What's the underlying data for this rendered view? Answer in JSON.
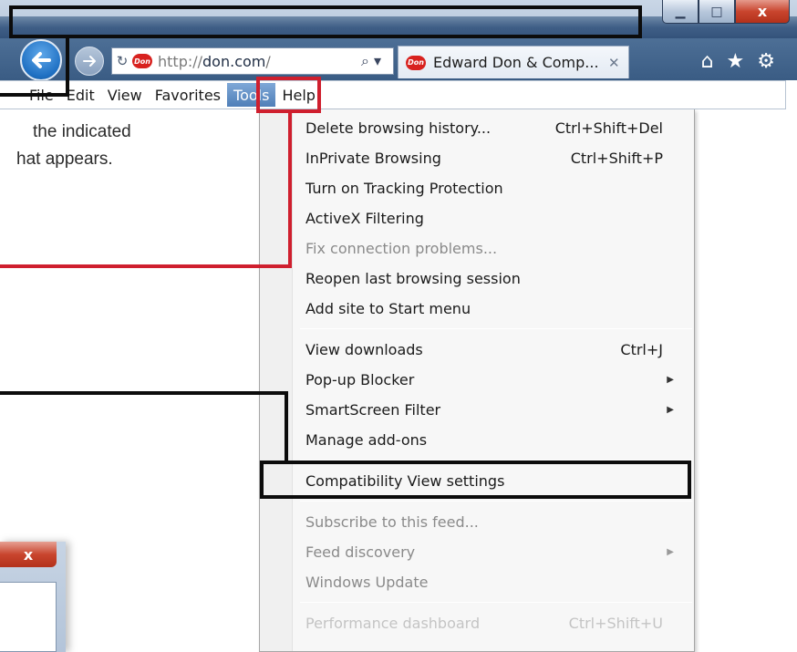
{
  "window": {
    "minimize_glyph": "▁",
    "maximize_glyph": "□",
    "close_glyph": "x"
  },
  "nav": {
    "back_icon": "back-arrow-icon",
    "forward_icon": "forward-arrow-icon",
    "refresh_glyph": "↻",
    "site_logo_text": "Don",
    "url_scheme": "http://",
    "url_host": "don.com",
    "url_tail": "/",
    "search_glyph": "⌕ ▾",
    "tab_title": "Edward Don & Comp...",
    "tab_close_glyph": "✕",
    "home_glyph": "⌂",
    "favorites_glyph": "★",
    "tools_glyph": "⚙"
  },
  "menubar": {
    "items": [
      "File",
      "Edit",
      "View",
      "Favorites",
      "Tools",
      "Help"
    ],
    "active": "Tools"
  },
  "callout": {
    "line1": "the indicated",
    "line2": "hat appears."
  },
  "dropdown": {
    "items": [
      {
        "label": "Delete browsing history...",
        "shortcut": "Ctrl+Shift+Del"
      },
      {
        "label": "InPrivate Browsing",
        "shortcut": "Ctrl+Shift+P"
      },
      {
        "label": "Turn on Tracking Protection",
        "shortcut": ""
      },
      {
        "label": "ActiveX Filtering",
        "shortcut": ""
      },
      {
        "label": "Fix connection problems...",
        "shortcut": "",
        "state": "disabled"
      },
      {
        "label": "Reopen last browsing session",
        "shortcut": ""
      },
      {
        "label": "Add site to Start menu",
        "shortcut": ""
      },
      {
        "label": "View downloads",
        "shortcut": "Ctrl+J"
      },
      {
        "label": "Pop-up Blocker",
        "shortcut": "",
        "submenu": true
      },
      {
        "label": "SmartScreen Filter",
        "shortcut": "",
        "submenu": true
      },
      {
        "label": "Manage add-ons",
        "shortcut": ""
      },
      {
        "label": "Compatibility View settings",
        "shortcut": ""
      },
      {
        "label": "Subscribe to this feed...",
        "shortcut": "",
        "state": "disabled"
      },
      {
        "label": "Feed discovery",
        "shortcut": "",
        "submenu": true,
        "state": "disabled"
      },
      {
        "label": "Windows Update",
        "shortcut": "",
        "state": "disabled"
      },
      {
        "label": "Performance dashboard",
        "shortcut": "Ctrl+Shift+U",
        "state": "faded"
      }
    ],
    "submenu_glyph": "▶"
  },
  "mini_dialog": {
    "close_glyph": "x"
  },
  "colors": {
    "annotation_black": "#0c0c0c",
    "annotation_red": "#cf1f2e",
    "menu_active": "#4f7fb8"
  }
}
